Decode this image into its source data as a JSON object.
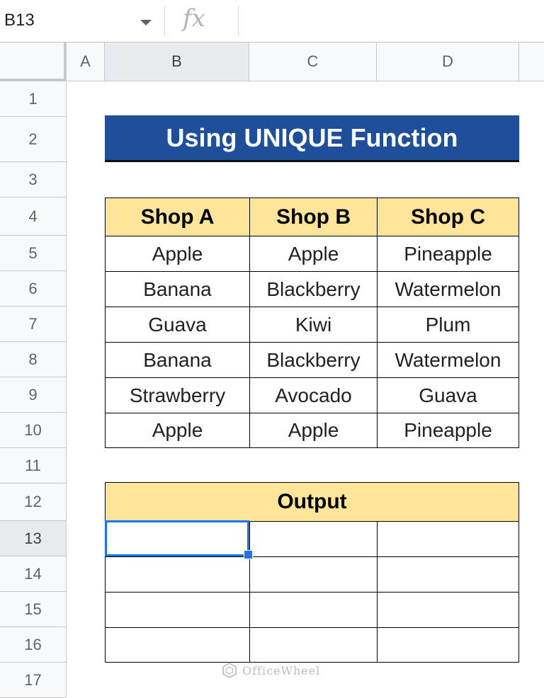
{
  "name_box": {
    "value": "B13"
  },
  "formula_bar": {
    "fx_label": "fx",
    "value": ""
  },
  "columns": [
    "A",
    "B",
    "C",
    "D"
  ],
  "rows": [
    "1",
    "2",
    "3",
    "4",
    "5",
    "6",
    "7",
    "8",
    "9",
    "10",
    "11",
    "12",
    "13",
    "14",
    "15",
    "16",
    "17"
  ],
  "active_cell": {
    "column": "B",
    "row": "13"
  },
  "title": "Using UNIQUE Function",
  "table": {
    "headers": [
      "Shop A",
      "Shop B",
      "Shop C"
    ],
    "rows": [
      [
        "Apple",
        "Apple",
        "Pineapple"
      ],
      [
        "Banana",
        "Blackberry",
        "Watermelon"
      ],
      [
        "Guava",
        "Kiwi",
        "Plum"
      ],
      [
        "Banana",
        "Blackberry",
        "Watermelon"
      ],
      [
        "Strawberry",
        "Avocado",
        "Guava"
      ],
      [
        "Apple",
        "Apple",
        "Pineapple"
      ]
    ]
  },
  "output": {
    "header": "Output",
    "rows": [
      [
        "",
        "",
        ""
      ],
      [
        "",
        "",
        ""
      ],
      [
        "",
        "",
        ""
      ],
      [
        "",
        "",
        ""
      ]
    ]
  },
  "watermark": "OfficeWheel",
  "colors": {
    "title_bg": "#1f4e9a",
    "header_bg": "#ffe59a",
    "selection": "#1a73e8"
  }
}
